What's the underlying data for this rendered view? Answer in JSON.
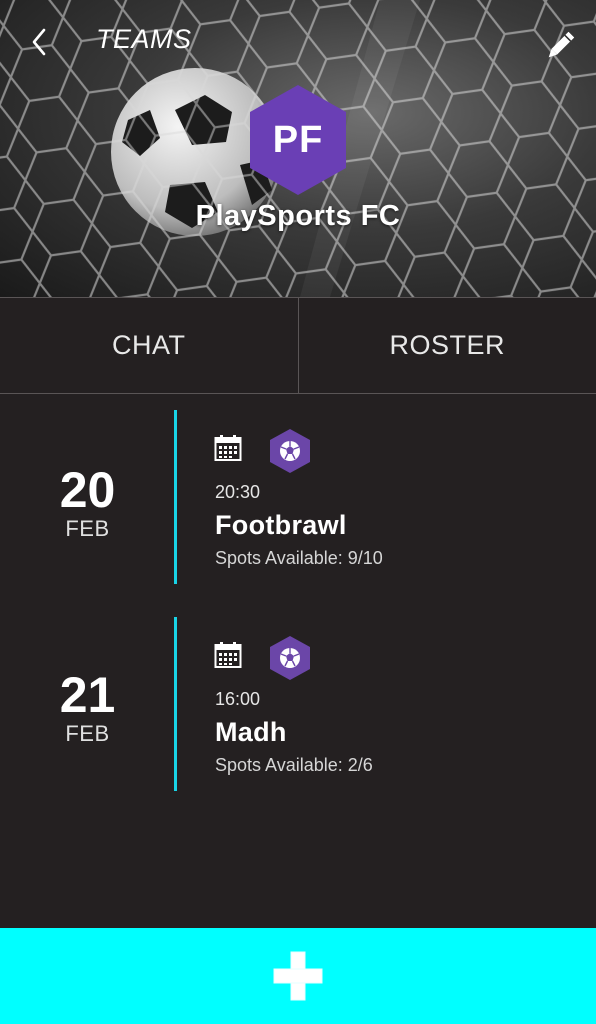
{
  "header": {
    "back_icon": "chevron-left-icon",
    "title": "TEAMS",
    "edit_icon": "pencil-icon",
    "team_initials": "PF",
    "team_name": "PlaySports FC",
    "badge_color": "#6a3fb5"
  },
  "tabs": [
    {
      "label": "CHAT"
    },
    {
      "label": "ROSTER"
    }
  ],
  "events": [
    {
      "day": "20",
      "month": "FEB",
      "time": "20:30",
      "title": "Footbrawl",
      "spots": "Spots Available: 9/10",
      "calendar_icon": "calendar-icon",
      "sport_icon": "soccer-ball-icon"
    },
    {
      "day": "21",
      "month": "FEB",
      "time": "16:00",
      "title": "Madh",
      "spots": "Spots Available: 2/6",
      "calendar_icon": "calendar-icon",
      "sport_icon": "soccer-ball-icon"
    }
  ],
  "add_button": {
    "icon": "plus-icon"
  },
  "colors": {
    "background": "#242021",
    "accent": "#19d3e6",
    "add_bar": "#00ffff",
    "badge": "#6a3fb5"
  }
}
